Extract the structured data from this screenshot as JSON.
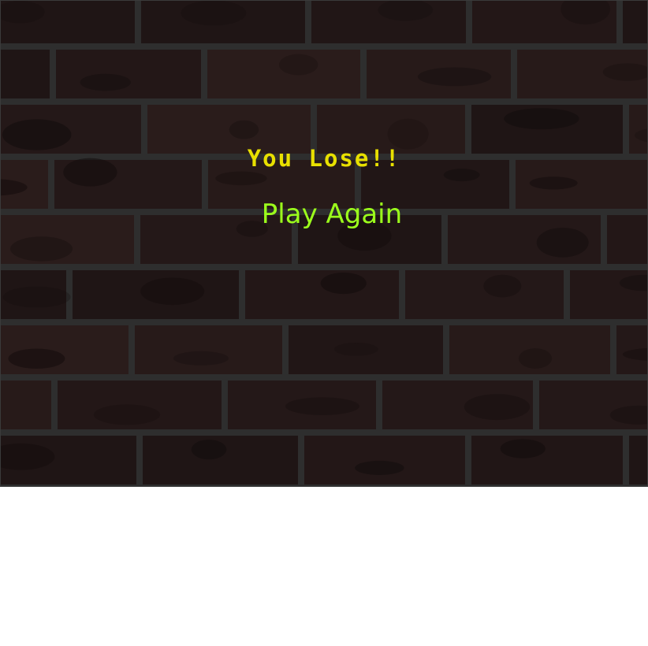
{
  "screen": {
    "background_color": "#1e1414",
    "brick_color": "#231717",
    "mortar_color": "#2e2e2e"
  },
  "status": {
    "message": "You Lose!!",
    "message_color": "#e8e000"
  },
  "actions": {
    "play_again_label": "Play Again",
    "play_again_color": "#9cff1c"
  }
}
